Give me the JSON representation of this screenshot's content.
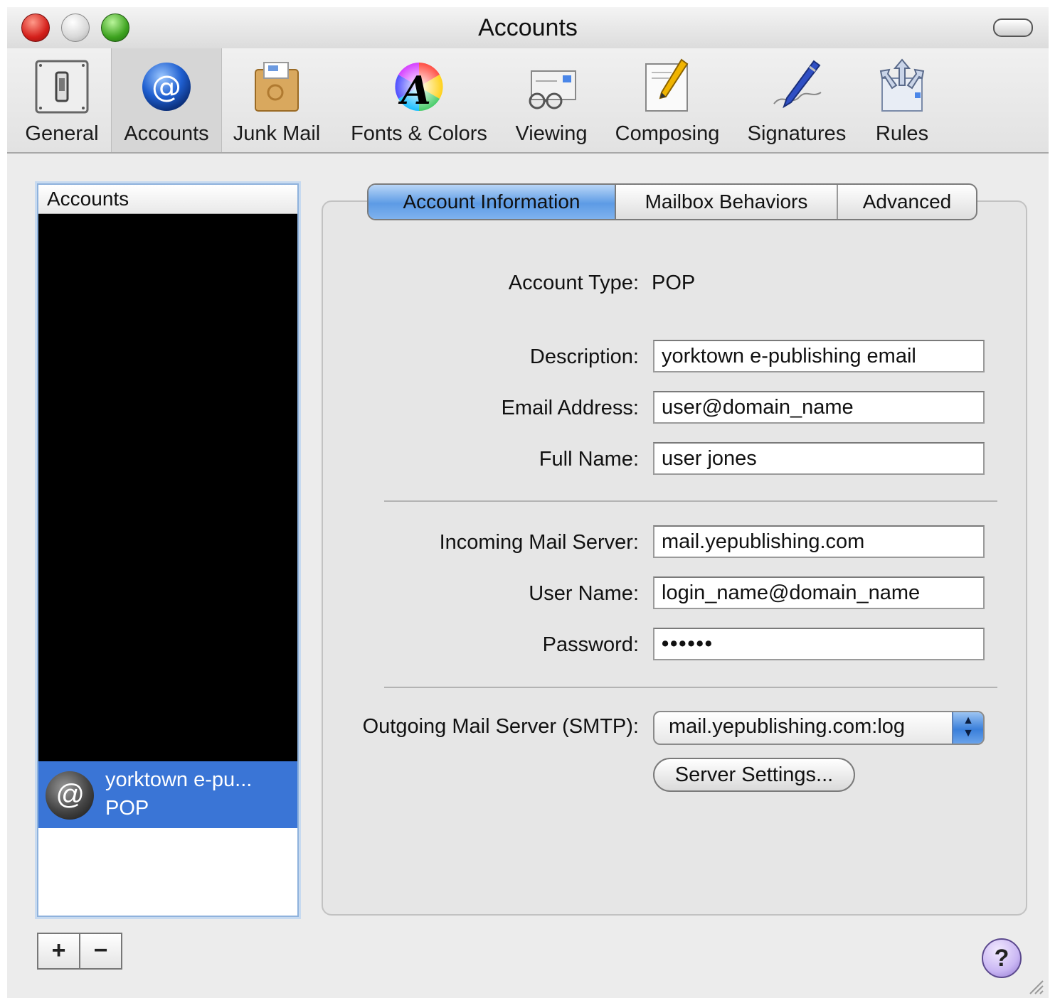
{
  "window": {
    "title": "Accounts"
  },
  "toolbar": {
    "items": [
      {
        "label": "General",
        "icon": "general-switch-icon"
      },
      {
        "label": "Accounts",
        "icon": "at-sign-icon",
        "selected": true
      },
      {
        "label": "Junk Mail",
        "icon": "junk-mail-box-icon"
      },
      {
        "label": "Fonts & Colors",
        "icon": "fonts-colors-icon"
      },
      {
        "label": "Viewing",
        "icon": "viewing-glasses-icon"
      },
      {
        "label": "Composing",
        "icon": "composing-pencil-icon"
      },
      {
        "label": "Signatures",
        "icon": "signatures-pen-icon"
      },
      {
        "label": "Rules",
        "icon": "rules-arrows-icon"
      }
    ]
  },
  "accounts_list": {
    "header": "Accounts",
    "selected_account": {
      "name": "yorktown e-pu...",
      "type": "POP"
    },
    "add_label": "+",
    "remove_label": "−"
  },
  "tabs": [
    {
      "label": "Account Information",
      "selected": true
    },
    {
      "label": "Mailbox Behaviors"
    },
    {
      "label": "Advanced"
    }
  ],
  "form": {
    "account_type_label": "Account Type:",
    "account_type_value": "POP",
    "description_label": "Description:",
    "description_value": "yorktown e-publishing email",
    "email_label": "Email Address:",
    "email_value": "user@domain_name",
    "full_name_label": "Full Name:",
    "full_name_value": "user jones",
    "incoming_label": "Incoming Mail Server:",
    "incoming_value": "mail.yepublishing.com",
    "username_label": "User Name:",
    "username_value": "login_name@domain_name",
    "password_label": "Password:",
    "password_value": "••••••",
    "smtp_label": "Outgoing Mail Server (SMTP):",
    "smtp_value": "mail.yepublishing.com:log",
    "server_settings_label": "Server Settings...",
    "help_label": "?"
  },
  "colors": {
    "selection_blue": "#3a75d6",
    "tab_selected": "#5d9be5",
    "window_bg": "#ececec"
  }
}
